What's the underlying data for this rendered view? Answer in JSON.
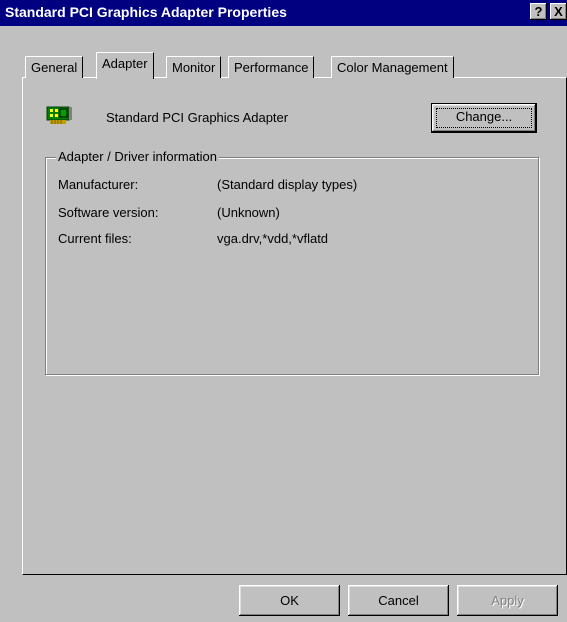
{
  "window": {
    "title": "Standard PCI Graphics Adapter Properties",
    "help_label": "?",
    "close_label": "X"
  },
  "tabs": [
    {
      "label": "General"
    },
    {
      "label": "Adapter",
      "active": true
    },
    {
      "label": "Monitor"
    },
    {
      "label": "Performance"
    },
    {
      "label": "Color Management"
    }
  ],
  "adapter": {
    "name": "Standard PCI Graphics Adapter",
    "icon": "graphics-card-icon",
    "change_label": "Change..."
  },
  "info_group": {
    "legend": "Adapter / Driver information",
    "rows": [
      {
        "label": "Manufacturer:",
        "value": "(Standard display types)"
      },
      {
        "label": "Software version:",
        "value": "(Unknown)"
      },
      {
        "label": "Current files:",
        "value": "vga.drv,*vdd,*vflatd"
      }
    ]
  },
  "buttons": {
    "ok": "OK",
    "cancel": "Cancel",
    "apply": "Apply"
  },
  "colors": {
    "title_bar": "#000080",
    "face": "#c0c0c0",
    "disabled_text": "#808080"
  }
}
